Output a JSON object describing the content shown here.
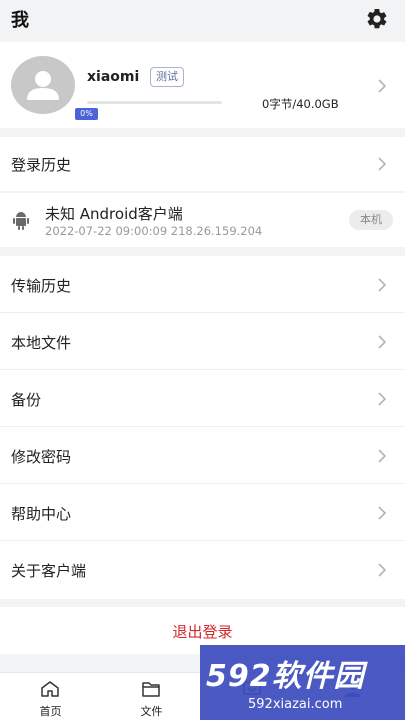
{
  "header": {
    "title": "我",
    "settings_icon": "gear-icon"
  },
  "profile": {
    "username": "xiaomi",
    "tag": "测试",
    "storage_percent": 0,
    "storage_percent_label": "0%",
    "usage": "0字节/40.0GB",
    "avatar_icon": "user-avatar-icon"
  },
  "login_history": {
    "label": "登录历史"
  },
  "device": {
    "icon": "android-icon",
    "name": "未知 Android客户端",
    "meta": "2022-07-22 09:00:09 218.26.159.204",
    "badge": "本机"
  },
  "menu": [
    {
      "label": "传输历史"
    },
    {
      "label": "本地文件"
    },
    {
      "label": "备份"
    },
    {
      "label": "修改密码"
    },
    {
      "label": "帮助中心"
    },
    {
      "label": "关于客户端"
    }
  ],
  "logout": {
    "label": "退出登录"
  },
  "tabbar": [
    {
      "label": "首页",
      "icon": "home-icon"
    },
    {
      "label": "文件",
      "icon": "folder-icon"
    },
    {
      "label": "",
      "icon": "transfer-icon"
    },
    {
      "label": "",
      "icon": "user-icon"
    }
  ],
  "watermark": {
    "big": "592软件园",
    "small": "592xiazai.com"
  },
  "colors": {
    "accent": "#4a63d8",
    "logout": "#d22a2a",
    "background": "#f2f3f5"
  }
}
